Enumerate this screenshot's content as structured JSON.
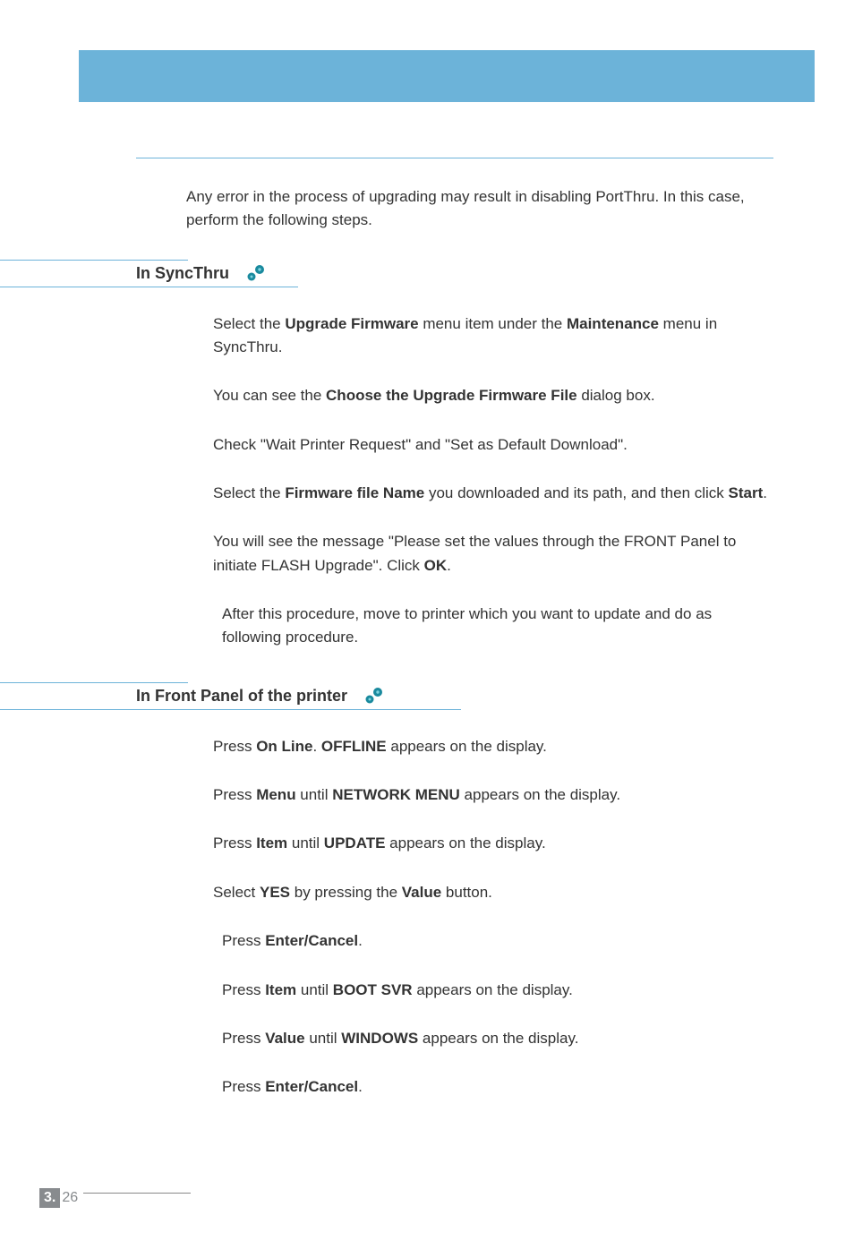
{
  "intro": "Any error in the process of upgrading may result in disabling PortThru. In this case, perform the following steps.",
  "section1": {
    "heading": "In SyncThru",
    "steps": {
      "s1_pre": "Select the ",
      "s1_b1": "Upgrade Firmware",
      "s1_mid": " menu item under the ",
      "s1_b2": "Maintenance",
      "s1_post": " menu in SyncThru.",
      "s2_pre": "You can see the ",
      "s2_b1": "Choose the Upgrade Firmware File",
      "s2_post": " dialog box.",
      "s3": "Check \"Wait Printer Request\" and \"Set as Default Download\".",
      "s4_pre": "Select the ",
      "s4_b1": "Firmware file Name",
      "s4_mid": " you downloaded and its path, and then click ",
      "s4_b2": "Start",
      "s4_post": ".",
      "s5_pre": "You will see the message \"Please set the values through the FRONT Panel to initiate FLASH Upgrade\". Click ",
      "s5_b1": "OK",
      "s5_post": "."
    },
    "note": "After this procedure, move to printer which you want to update and do as following procedure."
  },
  "section2": {
    "heading": "In Front Panel of the printer",
    "steps": {
      "s1_pre": "Press ",
      "s1_b1": "On Line",
      "s1_mid": ". ",
      "s1_b2": "OFFLINE",
      "s1_post": " appears on the display.",
      "s2_pre": "Press ",
      "s2_b1": "Menu",
      "s2_mid": " until ",
      "s2_b2": "NETWORK MENU",
      "s2_post": " appears on the display.",
      "s3_pre": "Press ",
      "s3_b1": "Item",
      "s3_mid": " until ",
      "s3_b2": "UPDATE",
      "s3_post": " appears on the display.",
      "s4_pre": "Select ",
      "s4_b1": "YES",
      "s4_mid": " by pressing the ",
      "s4_b2": "Value",
      "s4_post": " button.",
      "s5_pre": "Press ",
      "s5_b1": "Enter/Cancel",
      "s5_post": ".",
      "s6_pre": "Press ",
      "s6_b1": "Item",
      "s6_mid": " until ",
      "s6_b2": "BOOT SVR",
      "s6_post": " appears on the display.",
      "s7_pre": "Press ",
      "s7_b1": "Value",
      "s7_mid": " until ",
      "s7_b2": "WINDOWS",
      "s7_post": " appears on the display.",
      "s8_pre": "Press ",
      "s8_b1": "Enter/Cancel",
      "s8_post": "."
    }
  },
  "page": {
    "chapter": "3.",
    "num": "26"
  }
}
